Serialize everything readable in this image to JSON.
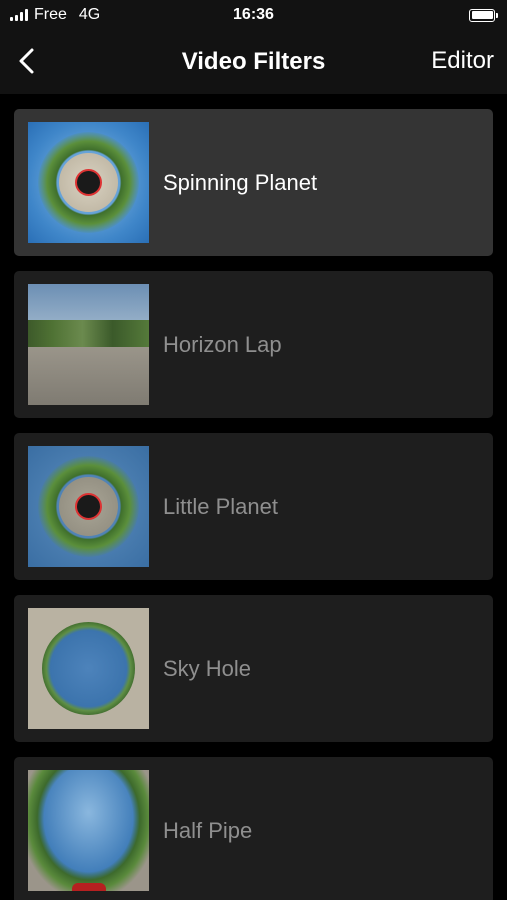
{
  "status_bar": {
    "carrier": "Free",
    "network": "4G",
    "time": "16:36"
  },
  "nav": {
    "title": "Video Filters",
    "editor_label": "Editor"
  },
  "filters": [
    {
      "label": "Spinning Planet",
      "selected": true,
      "thumbnail": "little-planet-thumb"
    },
    {
      "label": "Horizon Lap",
      "selected": false,
      "thumbnail": "horizon-thumb"
    },
    {
      "label": "Little Planet",
      "selected": false,
      "thumbnail": "little-planet-thumb"
    },
    {
      "label": "Sky Hole",
      "selected": false,
      "thumbnail": "sky-hole-thumb"
    },
    {
      "label": "Half Pipe",
      "selected": false,
      "thumbnail": "half-pipe-thumb"
    }
  ],
  "colors": {
    "background": "#000000",
    "card": "#1e1e1e",
    "card_selected": "#343434",
    "label_inactive": "#8f8f8f",
    "label_active": "#ffffff"
  }
}
